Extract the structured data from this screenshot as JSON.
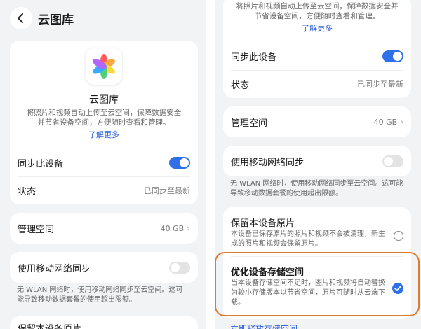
{
  "header": {
    "title": "云图库"
  },
  "app": {
    "name": "云图库",
    "description": "将照片和视频自动上传至云空间，保障数据安全并节省设备空间，方便随时查看和管理。",
    "learn_more": "了解更多"
  },
  "sync": {
    "label": "同步此设备",
    "enabled": true
  },
  "status": {
    "label": "状态",
    "value": "已同步至最新"
  },
  "manage": {
    "label": "管理空间",
    "value": "40 GB"
  },
  "mobile": {
    "label": "使用移动网络同步",
    "enabled": false,
    "note": "无 WLAN 网络时，使用移动网络同步至云空间。这可能导致移动数据套餐的使用超出限额。"
  },
  "keep_originals": {
    "label": "保留本设备原片",
    "description": "本设备已保存原片的照片和视频不会被清理，新生成的照片和视频会保留原片。",
    "selected": false,
    "left_partial": "保留本设备原片"
  },
  "optimize": {
    "label": "优化设备存储空间",
    "description": "当本设备存储空间不足时，图片和视频将自动替换为较小存储版本以节省空间，原片可随时从云端下载。",
    "selected": true
  },
  "right_top": {
    "line1": "将照片和视频自动上传至云空间，保障数据安全并",
    "line2": "节省设备空间，方便随时查看和管理。",
    "learn_more": "了解更多"
  },
  "free_space_link": "立即释放存储空间",
  "colors": {
    "accent": "#2f6fe8",
    "highlight": "#e07a2f"
  }
}
